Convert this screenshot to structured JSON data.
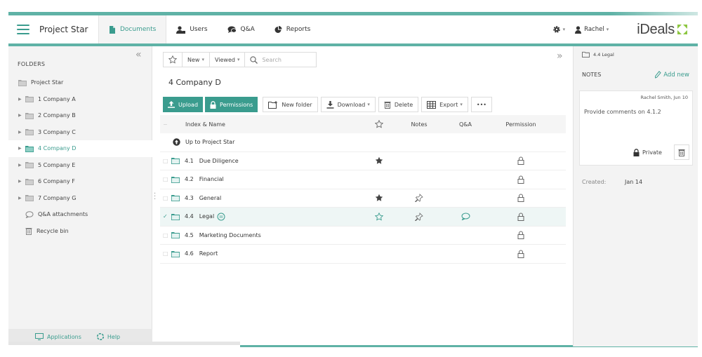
{
  "header": {
    "project_name": "Project Star",
    "nav": [
      {
        "label": "Documents",
        "icon": "document-icon",
        "active": true
      },
      {
        "label": "Users",
        "icon": "users-icon"
      },
      {
        "label": "Q&A",
        "icon": "chat-icon"
      },
      {
        "label": "Reports",
        "icon": "pie-chart-icon"
      }
    ],
    "user_name": "Rachel",
    "logo_text": "iDeals"
  },
  "colors": {
    "accent": "#3a9c8e",
    "strip": "#5fb2a6"
  },
  "sidebar": {
    "title": "FOLDERS",
    "items": [
      {
        "label": "Project Star"
      },
      {
        "label": "1 Company A"
      },
      {
        "label": "2 Company B"
      },
      {
        "label": "3 Company C"
      },
      {
        "label": "4 Company D",
        "active": true
      },
      {
        "label": "5 Company E"
      },
      {
        "label": "6 Company F"
      },
      {
        "label": "7 Company G"
      },
      {
        "label": "Q&A attachments"
      },
      {
        "label": "Recycle bin"
      }
    ],
    "footer": {
      "applications": "Applications",
      "help": "Help"
    }
  },
  "toolbar": {
    "new_label": "New",
    "viewed_label": "Viewed",
    "search_placeholder": "Search",
    "upload": "Upload",
    "permissions": "Permissions",
    "new_folder": "New folder",
    "download": "Download",
    "delete": "Delete",
    "export": "Export",
    "more": "•••"
  },
  "main": {
    "folder_title": "4 Company D",
    "columns": {
      "name": "Index & Name",
      "notes": "Notes",
      "qa": "Q&A",
      "permission": "Permission"
    },
    "up_link": "Up to Project Star",
    "rows": [
      {
        "index": "4.1",
        "name": "Due Diligence",
        "starred": true,
        "pinned": false,
        "qa": false
      },
      {
        "index": "4.2",
        "name": "Financial",
        "starred": false,
        "pinned": false,
        "qa": false
      },
      {
        "index": "4.3",
        "name": "General",
        "starred": true,
        "pinned": true,
        "qa": false
      },
      {
        "index": "4.4",
        "name": "Legal",
        "starred": false,
        "pinned": true,
        "qa": true,
        "selected": true
      },
      {
        "index": "4.5",
        "name": "Marketing Documents",
        "starred": false,
        "pinned": false,
        "qa": false
      },
      {
        "index": "4.6",
        "name": "Report",
        "starred": false,
        "pinned": false,
        "qa": false
      }
    ]
  },
  "right_panel": {
    "path": "4.4 Legal",
    "notes_title": "NOTES",
    "add_new": "Add new",
    "note": {
      "author": "Rachel Smith, Jun 10",
      "text": "Provide comments on 4.1.2",
      "private_label": "Private"
    },
    "created_label": "Created:",
    "created_value": "Jan 14"
  }
}
